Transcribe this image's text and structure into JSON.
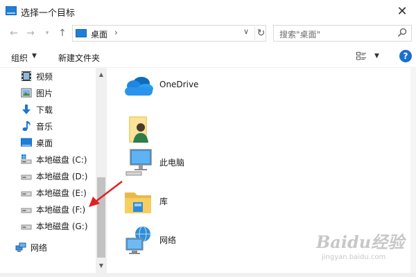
{
  "window": {
    "title": "选择一个目标"
  },
  "address": {
    "path": "桌面",
    "separator": "›"
  },
  "search": {
    "placeholder": "搜索\"桌面\""
  },
  "toolbar": {
    "organize": "组织",
    "new_folder": "新建文件夹",
    "help": "?"
  },
  "nav_items": [
    {
      "label": "视频",
      "icon": "video-icon"
    },
    {
      "label": "图片",
      "icon": "pictures-icon"
    },
    {
      "label": "下载",
      "icon": "download-icon"
    },
    {
      "label": "音乐",
      "icon": "music-icon"
    },
    {
      "label": "桌面",
      "icon": "desktop-icon"
    },
    {
      "label": "本地磁盘 (C:)",
      "icon": "system-drive-icon"
    },
    {
      "label": "本地磁盘 (D:)",
      "icon": "drive-icon"
    },
    {
      "label": "本地磁盘 (E:)",
      "icon": "drive-icon"
    },
    {
      "label": "本地磁盘 (F:)",
      "icon": "drive-icon"
    },
    {
      "label": "本地磁盘 (G:)",
      "icon": "drive-icon"
    },
    {
      "label": "网络",
      "icon": "network-icon"
    }
  ],
  "content_items": [
    {
      "label": "OneDrive",
      "icon": "onedrive-icon"
    },
    {
      "label": "",
      "icon": "user-folder-icon"
    },
    {
      "label": "此电脑",
      "icon": "this-pc-icon"
    },
    {
      "label": "库",
      "icon": "library-icon"
    },
    {
      "label": "网络",
      "icon": "network-icon"
    }
  ],
  "watermark": {
    "text": "Baidu经验",
    "url_text": "jingyan.baidu.com"
  },
  "colors": {
    "accent": "#1f7fd8",
    "arrow": "#e02020",
    "help": "#1c6fd0"
  }
}
